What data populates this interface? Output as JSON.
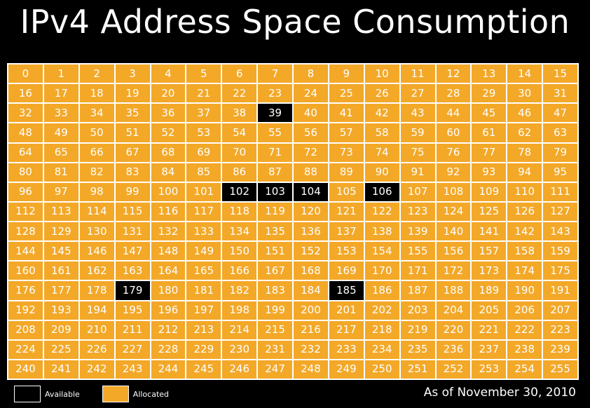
{
  "chart_data": {
    "type": "heatmap",
    "title": "IPv4 Address Space Consumption",
    "rows": 16,
    "columns": 16,
    "values": [
      0,
      1,
      2,
      3,
      4,
      5,
      6,
      7,
      8,
      9,
      10,
      11,
      12,
      13,
      14,
      15,
      16,
      17,
      18,
      19,
      20,
      21,
      22,
      23,
      24,
      25,
      26,
      27,
      28,
      29,
      30,
      31,
      32,
      33,
      34,
      35,
      36,
      37,
      38,
      39,
      40,
      41,
      42,
      43,
      44,
      45,
      46,
      47,
      48,
      49,
      50,
      51,
      52,
      53,
      54,
      55,
      56,
      57,
      58,
      59,
      60,
      61,
      62,
      63,
      64,
      65,
      66,
      67,
      68,
      69,
      70,
      71,
      72,
      73,
      74,
      75,
      76,
      77,
      78,
      79,
      80,
      81,
      82,
      83,
      84,
      85,
      86,
      87,
      88,
      89,
      90,
      91,
      92,
      93,
      94,
      95,
      96,
      97,
      98,
      99,
      100,
      101,
      102,
      103,
      104,
      105,
      106,
      107,
      108,
      109,
      110,
      111,
      112,
      113,
      114,
      115,
      116,
      117,
      118,
      119,
      120,
      121,
      122,
      123,
      124,
      125,
      126,
      127,
      128,
      129,
      130,
      131,
      132,
      133,
      134,
      135,
      136,
      137,
      138,
      139,
      140,
      141,
      142,
      143,
      144,
      145,
      146,
      147,
      148,
      149,
      150,
      151,
      152,
      153,
      154,
      155,
      156,
      157,
      158,
      159,
      160,
      161,
      162,
      163,
      164,
      165,
      166,
      167,
      168,
      169,
      170,
      171,
      172,
      173,
      174,
      175,
      176,
      177,
      178,
      179,
      180,
      181,
      182,
      183,
      184,
      185,
      186,
      187,
      188,
      189,
      190,
      191,
      192,
      193,
      194,
      195,
      196,
      197,
      198,
      199,
      200,
      201,
      202,
      203,
      204,
      205,
      206,
      207,
      208,
      209,
      210,
      211,
      212,
      213,
      214,
      215,
      216,
      217,
      218,
      219,
      220,
      221,
      222,
      223,
      224,
      225,
      226,
      227,
      228,
      229,
      230,
      231,
      232,
      233,
      234,
      235,
      236,
      237,
      238,
      239,
      240,
      241,
      242,
      243,
      244,
      245,
      246,
      247,
      248,
      249,
      250,
      251,
      252,
      253,
      254,
      255
    ],
    "available": [
      39,
      102,
      103,
      104,
      106,
      179,
      185
    ],
    "legend": [
      {
        "label": "Available",
        "color": "#000000"
      },
      {
        "label": "Allocated",
        "color": "#f3a828"
      }
    ],
    "annotation": "As of November 30, 2010",
    "xlabel": "",
    "ylabel": ""
  }
}
